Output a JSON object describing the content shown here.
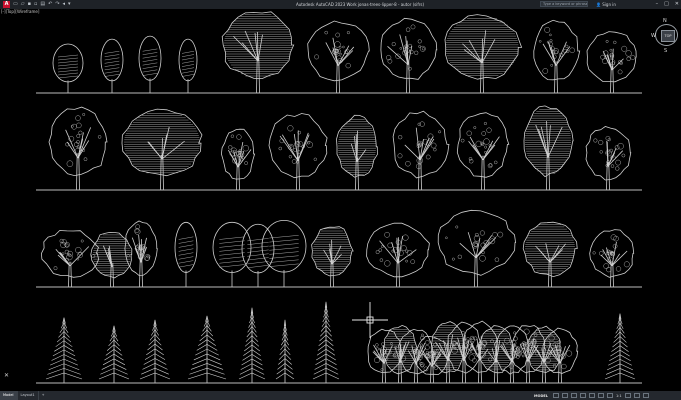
{
  "window": {
    "title": "Autodesk AutoCAD 2023   Work jonas-trees-lipper-8 - autor (sifrs)",
    "search_placeholder": "Type a keyword or phrase",
    "user_label": "Sign in",
    "minimize": "–",
    "maximize": "□",
    "close": "✕"
  },
  "viewport": {
    "label": "[-][Top][Wireframe]"
  },
  "viewcube": {
    "north": "N",
    "south": "S",
    "west": "W",
    "top_face": "TOP"
  },
  "ucs": {
    "glyph": "✕"
  },
  "statusbar": {
    "tabs": [
      {
        "label": "Model"
      },
      {
        "label": "Layout1"
      }
    ],
    "add_tab": "+",
    "model_label": "MODEL",
    "scale": "1:1"
  },
  "colors": {
    "background": "#000000",
    "drawing_lines": "#cfcfcf",
    "titlebar": "#1e2227",
    "statusbar": "#24282e"
  }
}
